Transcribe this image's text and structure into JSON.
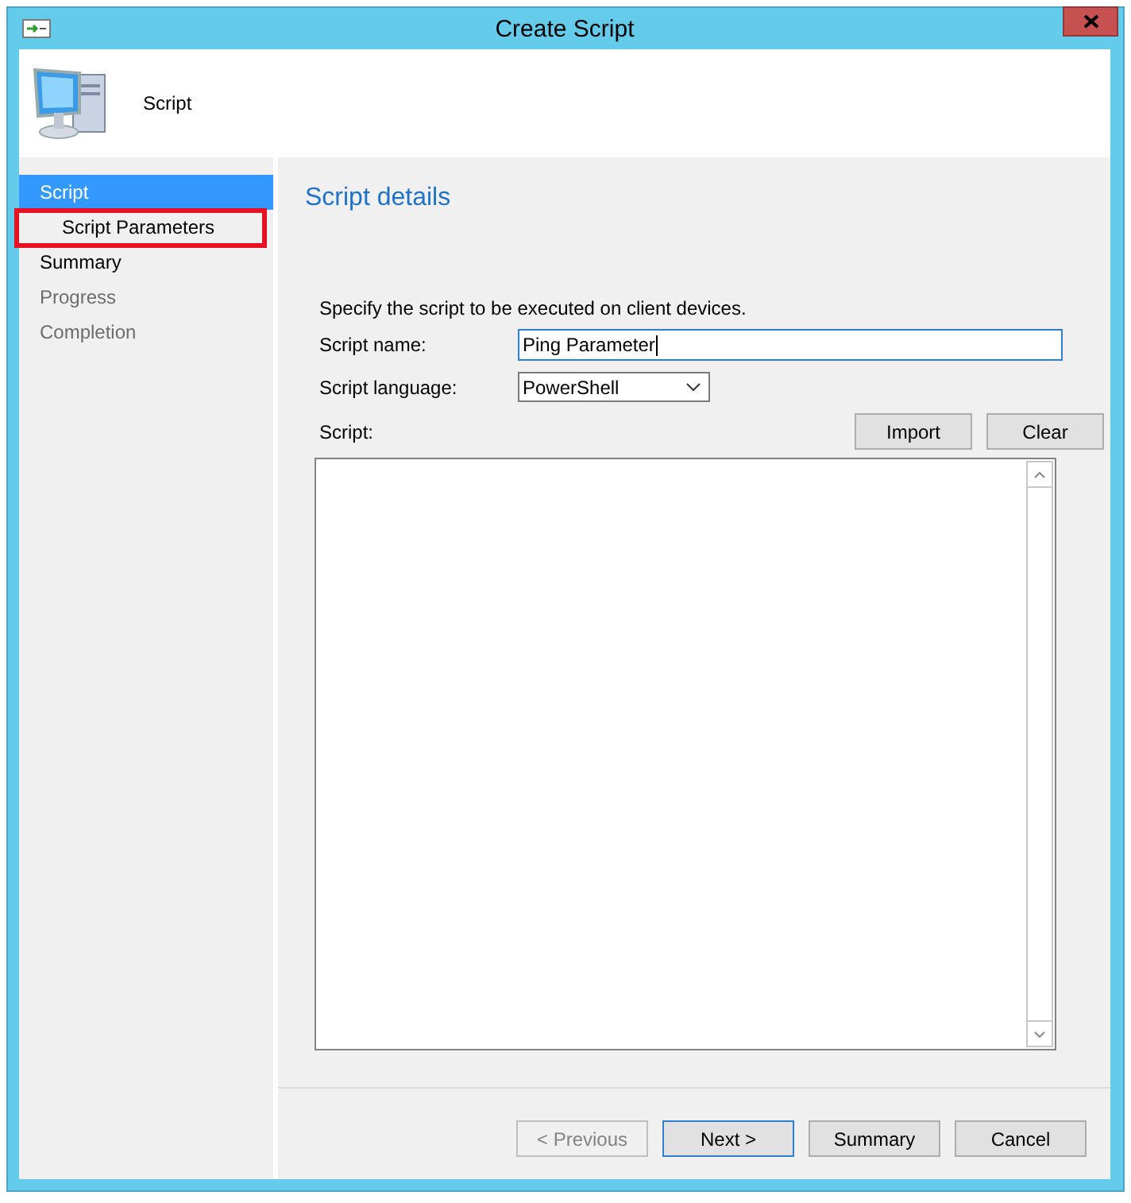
{
  "window": {
    "title": "Create Script"
  },
  "header": {
    "title": "Script"
  },
  "nav": [
    {
      "label": "Script",
      "selected": true,
      "disabled": false,
      "highlighted": false,
      "children": [
        {
          "label": "Script Parameters",
          "selected": false,
          "disabled": false,
          "highlighted": true
        }
      ]
    },
    {
      "label": "Summary",
      "selected": false,
      "disabled": false,
      "highlighted": false
    },
    {
      "label": "Progress",
      "selected": false,
      "disabled": true,
      "highlighted": false
    },
    {
      "label": "Completion",
      "selected": false,
      "disabled": true,
      "highlighted": false
    }
  ],
  "page": {
    "title": "Script details",
    "instruction": "Specify the script to be executed on client devices.",
    "fields": [
      {
        "kind": "text",
        "label": "Script name:",
        "value": "Ping Parameter"
      },
      {
        "kind": "dropdown",
        "label": "Script language:",
        "value": "PowerShell"
      }
    ],
    "script": {
      "label": "Script:",
      "buttons": [
        "Import",
        "Clear"
      ]
    }
  },
  "buttons": [
    {
      "label": "< Previous",
      "disabled": true,
      "default": false
    },
    {
      "label": "Next >",
      "disabled": false,
      "default": true
    },
    {
      "label": "Summary",
      "disabled": false,
      "default": false
    },
    {
      "label": "Cancel",
      "disabled": false,
      "default": false
    }
  ]
}
